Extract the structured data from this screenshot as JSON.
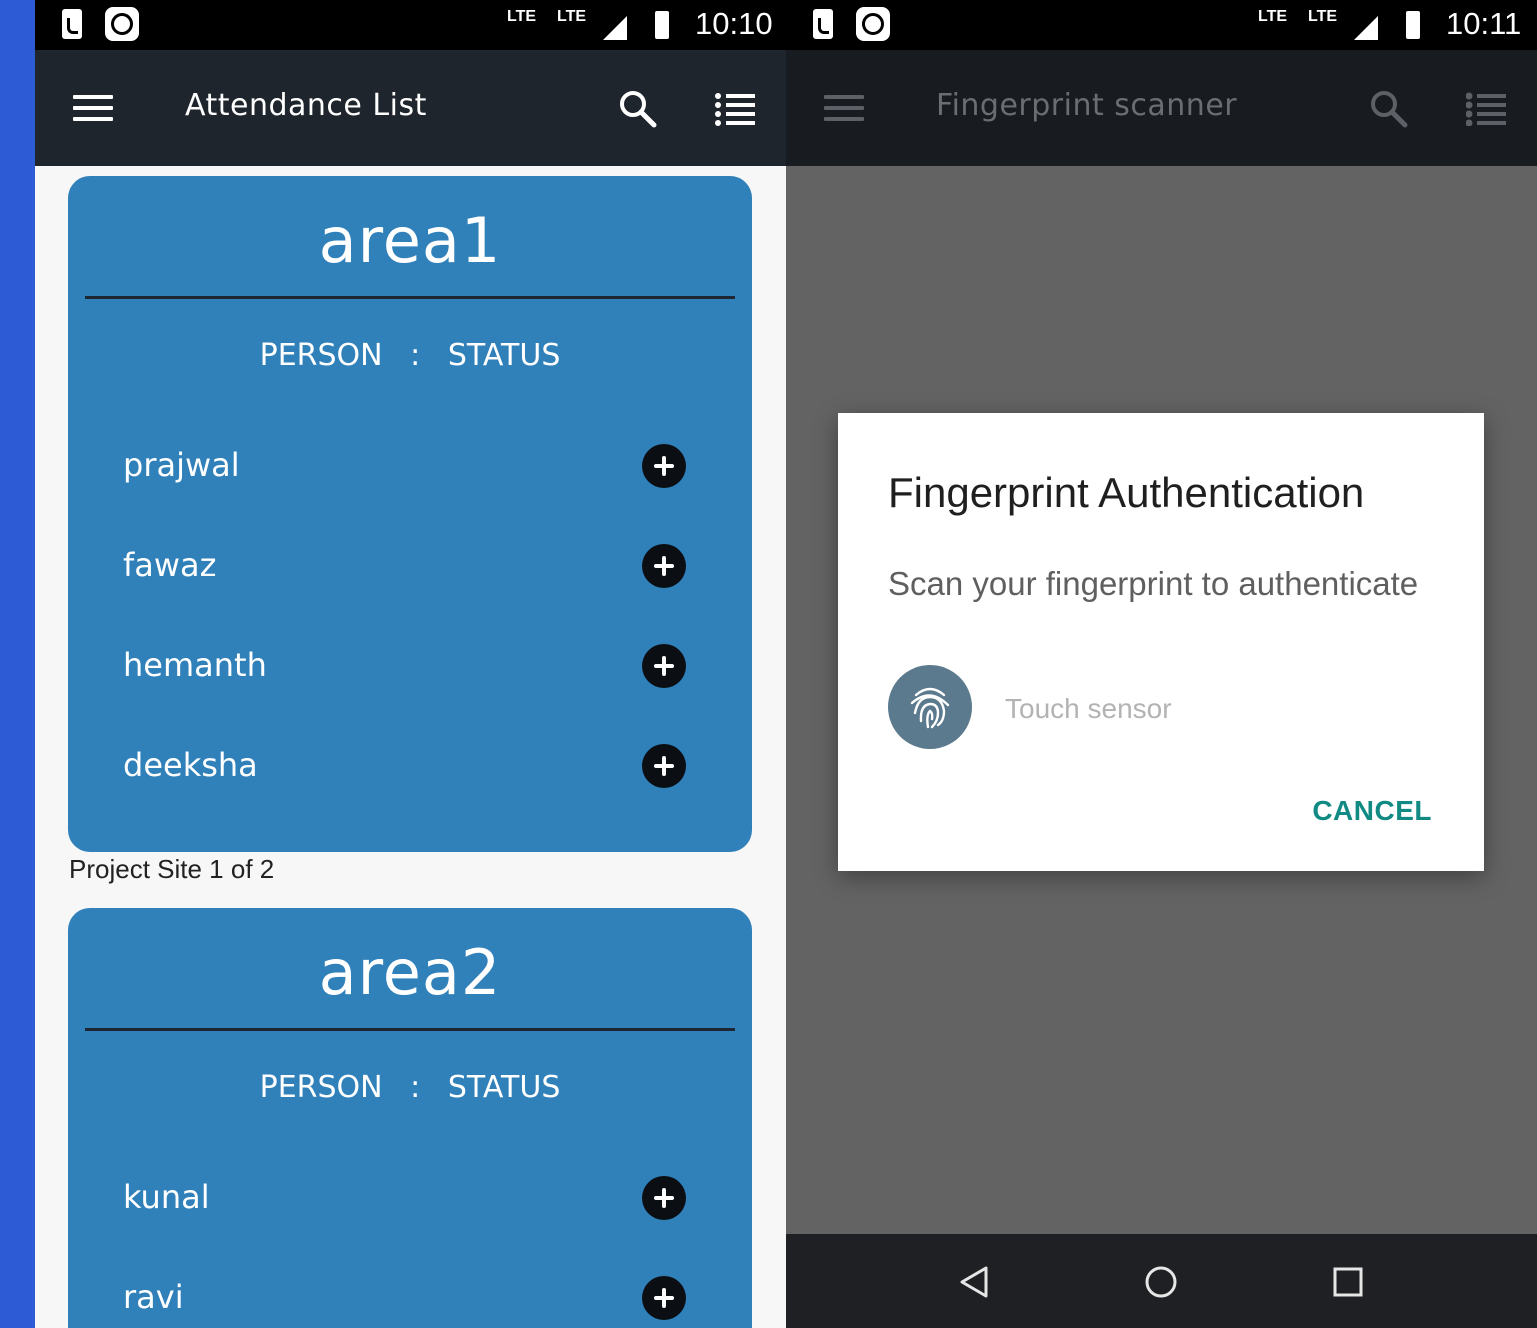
{
  "left_phone": {
    "status_bar": {
      "network_1": "LTE",
      "network_2": "LTE",
      "time": "10:10"
    },
    "app_bar": {
      "title": "Attendance List",
      "menu_icon": "hamburger-icon",
      "search_icon": "search-icon",
      "list_icon": "list-icon"
    },
    "areas": [
      {
        "title": "area1",
        "column_person": "PERSON",
        "column_separator": ":",
        "column_status": "STATUS",
        "people": [
          "prajwal",
          "fawaz",
          "hemanth",
          "deeksha"
        ]
      },
      {
        "title": "area2",
        "column_person": "PERSON",
        "column_separator": ":",
        "column_status": "STATUS",
        "people": [
          "kunal",
          "ravi"
        ]
      }
    ],
    "site_caption": "Project Site 1 of 2"
  },
  "right_phone": {
    "status_bar": {
      "network_1": "LTE",
      "network_2": "LTE",
      "time": "10:11"
    },
    "app_bar": {
      "title": "Fingerprint scanner"
    },
    "dialog": {
      "title": "Fingerprint Authentication",
      "message": "Scan your fingerprint to authenticate",
      "sensor_status": "Touch sensor",
      "cancel_label": "CANCEL",
      "fingerprint_icon": "fingerprint-icon"
    },
    "nav_bar": {
      "back_icon": "back-icon",
      "home_icon": "home-icon",
      "recents_icon": "recents-icon"
    }
  },
  "colors": {
    "background_blue": "#2d5bd6",
    "card_blue": "#3080ba",
    "app_bar": "#1f252c",
    "accent_teal": "#118a84",
    "fingerprint_badge": "#5c7a8d"
  }
}
